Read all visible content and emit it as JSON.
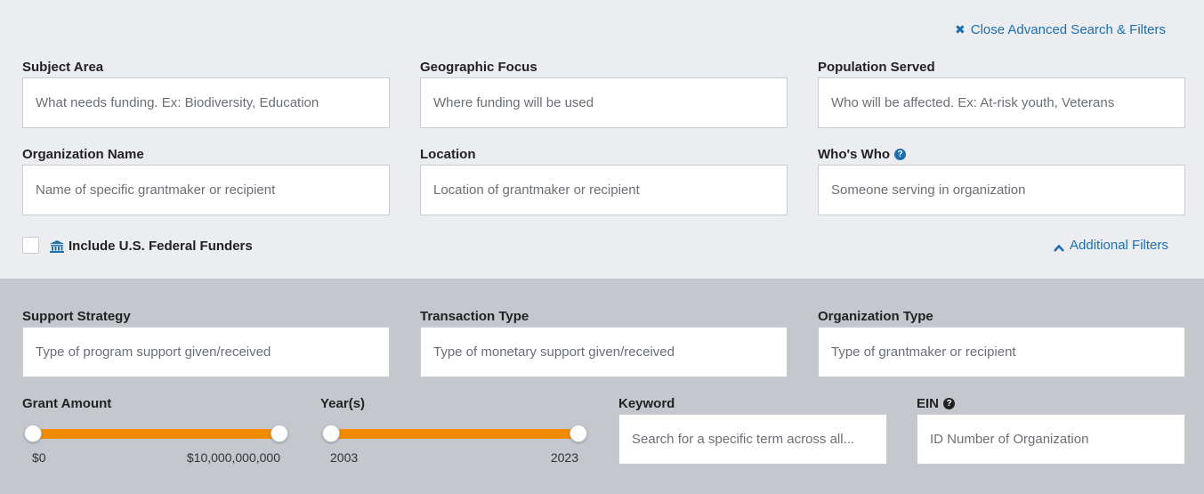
{
  "header": {
    "close_link": "Close Advanced Search & Filters",
    "additional_filters_link": "Additional Filters"
  },
  "fields": {
    "subject_area": {
      "label": "Subject Area",
      "placeholder": "What needs funding. Ex: Biodiversity, Education"
    },
    "geographic_focus": {
      "label": "Geographic Focus",
      "placeholder": "Where funding will be used"
    },
    "population_served": {
      "label": "Population Served",
      "placeholder": "Who will be affected. Ex: At-risk youth, Veterans"
    },
    "organization_name": {
      "label": "Organization Name",
      "placeholder": "Name of specific grantmaker or recipient"
    },
    "location": {
      "label": "Location",
      "placeholder": "Location of grantmaker or recipient"
    },
    "whos_who": {
      "label": "Who's Who",
      "placeholder": "Someone serving in organization"
    },
    "support_strategy": {
      "label": "Support Strategy",
      "placeholder": "Type of program support given/received"
    },
    "transaction_type": {
      "label": "Transaction Type",
      "placeholder": "Type of monetary support given/received"
    },
    "organization_type": {
      "label": "Organization Type",
      "placeholder": "Type of grantmaker or recipient"
    },
    "keyword": {
      "label": "Keyword",
      "placeholder": "Search for a specific term across all..."
    },
    "ein": {
      "label": "EIN",
      "placeholder": "ID Number of Organization"
    }
  },
  "federal": {
    "label": "Include U.S. Federal Funders",
    "checked": false
  },
  "grant_amount": {
    "label": "Grant Amount",
    "min_label": "$0",
    "max_label": "$10,000,000,000",
    "range_fraction": [
      0,
      1
    ]
  },
  "years": {
    "label": "Year(s)",
    "min_label": "2003",
    "max_label": "2023",
    "range_fraction": [
      0,
      1
    ]
  },
  "colors": {
    "accent": "#1f6fb0",
    "slider": "#f28b00",
    "top_bg": "#ebedf1",
    "bottom_bg": "#c4c8cd"
  },
  "icons": {
    "close": "close-icon",
    "chevron_up": "chevron-up-icon",
    "bank": "bank-icon",
    "help": "help-icon"
  }
}
